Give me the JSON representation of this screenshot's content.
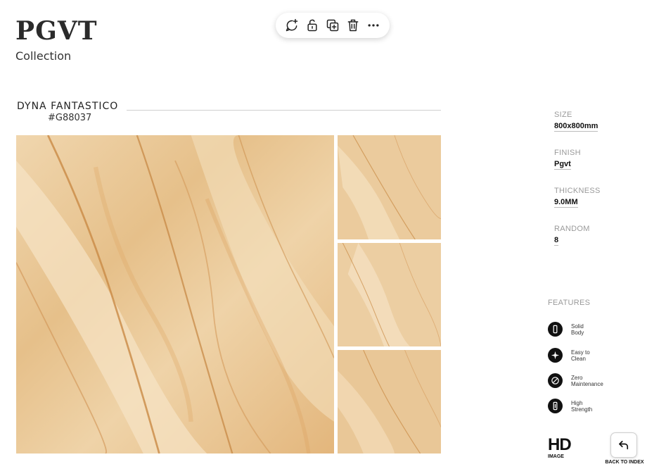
{
  "brand": {
    "title": "PGVT",
    "subtitle": "Collection"
  },
  "toolbar": {
    "items": [
      {
        "name": "comment-add",
        "icon": "comment-plus-icon"
      },
      {
        "name": "unlock",
        "icon": "unlock-icon"
      },
      {
        "name": "duplicate",
        "icon": "duplicate-icon"
      },
      {
        "name": "delete",
        "icon": "trash-icon"
      },
      {
        "name": "more",
        "icon": "more-horizontal-icon"
      }
    ]
  },
  "product": {
    "name": "DYNA FANTASTICO",
    "code": "#G88037"
  },
  "specs": [
    {
      "label": "SIZE",
      "value": "800x800mm"
    },
    {
      "label": "FINISH",
      "value": "Pgvt"
    },
    {
      "label": "THICKNESS",
      "value": "9.0MM"
    },
    {
      "label": "RANDOM",
      "value": "8"
    }
  ],
  "features": {
    "title": "FEATURES",
    "items": [
      {
        "line1": "Solid",
        "line2": "Body",
        "icon": "solid-body-icon"
      },
      {
        "line1": "Easy to",
        "line2": "Clean",
        "icon": "sparkle-icon"
      },
      {
        "line1": "Zero",
        "line2": "Maintenance",
        "icon": "no-symbol-icon"
      },
      {
        "line1": "High",
        "line2": "Strength",
        "icon": "strength-icon"
      }
    ]
  },
  "hd_badge": {
    "mark": "HD",
    "label": "IMAGE"
  },
  "back": {
    "label": "BACK TO INDEX",
    "icon": "return-arrow-icon"
  },
  "colors": {
    "tile_base": "#e9c99a",
    "tile_vein": "#c98a45",
    "tile_light": "#f5e2c2",
    "ink": "#111111"
  }
}
